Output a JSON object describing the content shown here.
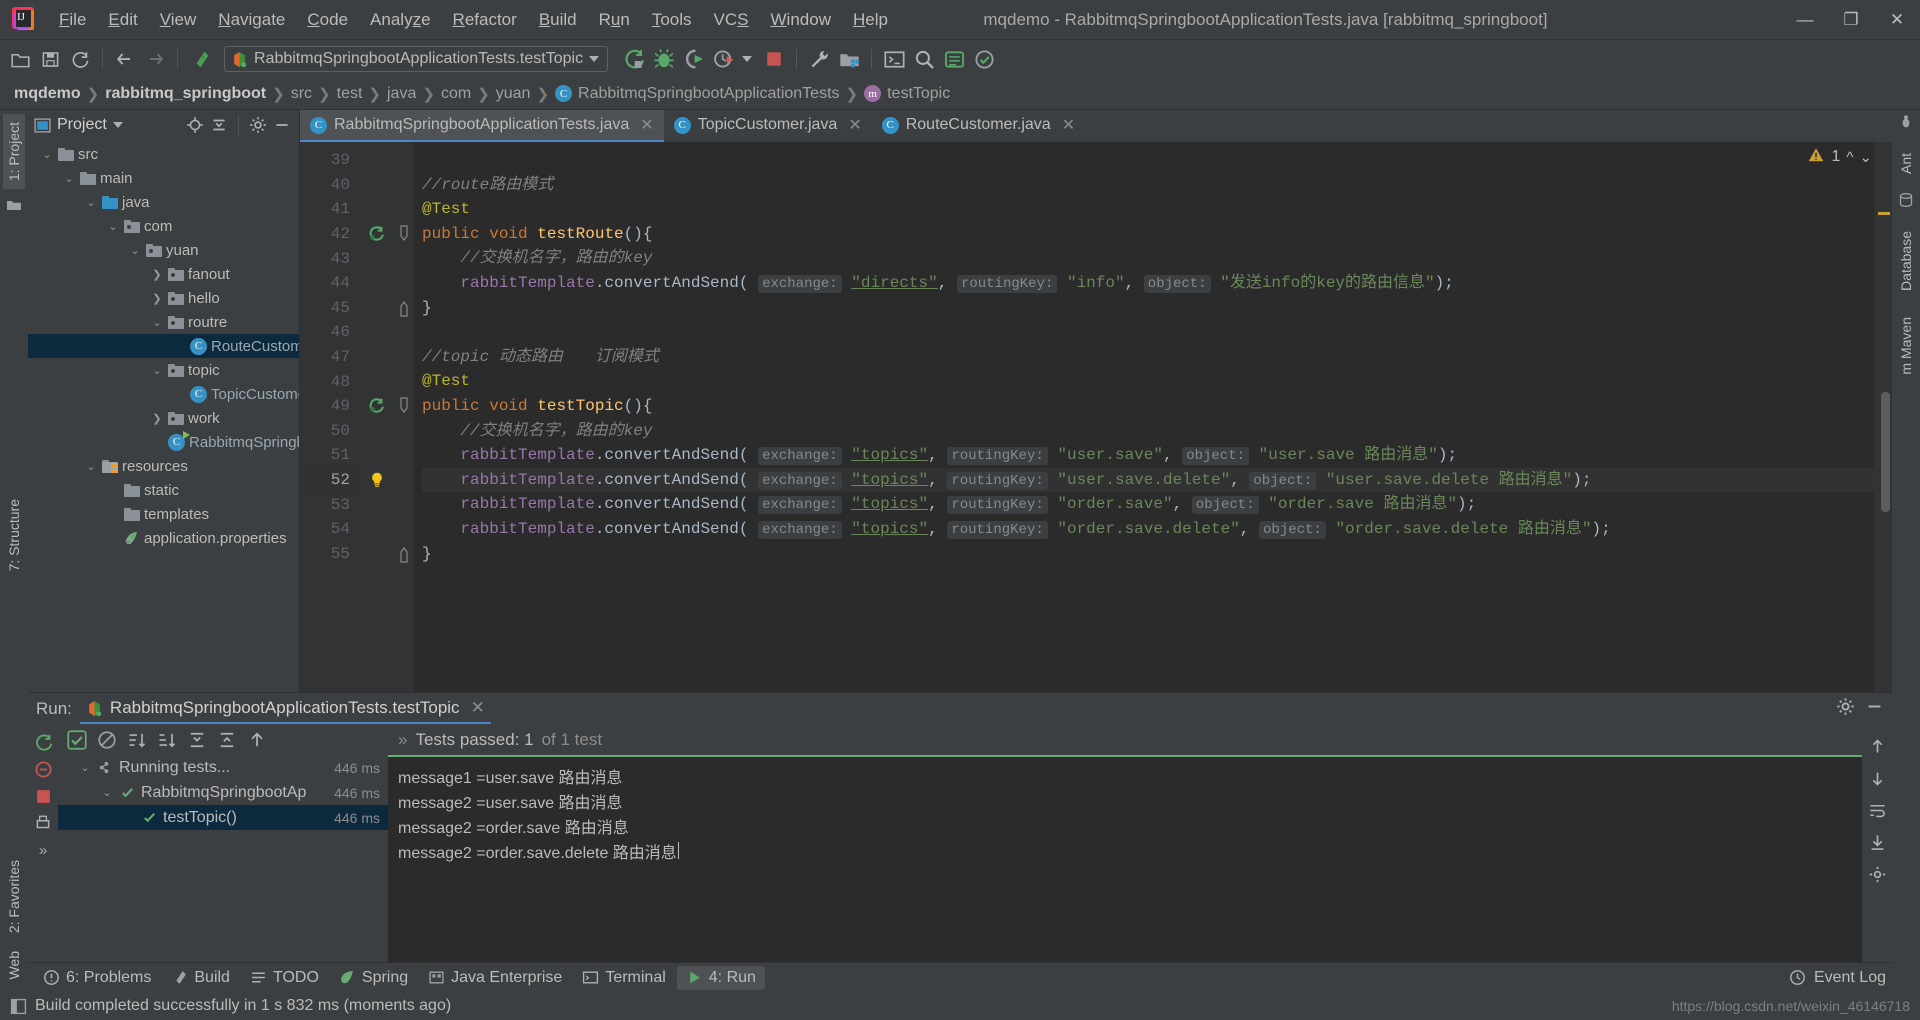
{
  "window": {
    "title": "mqdemo - RabbitmqSpringbootApplicationTests.java [rabbitmq_springboot]",
    "minimize": "—",
    "maximize": "❐",
    "close": "✕"
  },
  "menubar": [
    {
      "label": "File",
      "mnemonic": "F"
    },
    {
      "label": "Edit",
      "mnemonic": "E"
    },
    {
      "label": "View",
      "mnemonic": "V"
    },
    {
      "label": "Navigate",
      "mnemonic": "N"
    },
    {
      "label": "Code",
      "mnemonic": "C"
    },
    {
      "label": "Analyze",
      "mnemonic": "z"
    },
    {
      "label": "Refactor",
      "mnemonic": "R"
    },
    {
      "label": "Build",
      "mnemonic": "B"
    },
    {
      "label": "Run",
      "mnemonic": "u"
    },
    {
      "label": "Tools",
      "mnemonic": "T"
    },
    {
      "label": "VCS",
      "mnemonic": "S"
    },
    {
      "label": "Window",
      "mnemonic": "W"
    },
    {
      "label": "Help",
      "mnemonic": "H"
    }
  ],
  "toolbar": {
    "run_config": "RabbitmqSpringbootApplicationTests.testTopic",
    "icons": [
      "open-folder-icon",
      "save-icon",
      "sync-icon",
      "back-arrow-icon",
      "forward-arrow-icon",
      "build-icon",
      "run-icon",
      "debug-icon",
      "run-coverage-icon",
      "profile-icon",
      "stop-icon",
      "settings-wrench-icon",
      "project-structure-icon",
      "terminal-icon",
      "search-everywhere-icon",
      "database-icon",
      "check-icon"
    ]
  },
  "breadcrumb": [
    {
      "label": "mqdemo",
      "style": "bold"
    },
    {
      "label": "rabbitmq_springboot",
      "style": "bold"
    },
    {
      "label": "src",
      "style": "dim"
    },
    {
      "label": "test",
      "style": "dim"
    },
    {
      "label": "java",
      "style": "dim"
    },
    {
      "label": "com",
      "style": "dim"
    },
    {
      "label": "yuan",
      "style": "dim"
    },
    {
      "label": "RabbitmqSpringbootApplicationTests",
      "style": "class"
    },
    {
      "label": "testTopic",
      "style": "method"
    }
  ],
  "left_tool_tabs": [
    {
      "label": "1: Project",
      "selected": true
    },
    {
      "label": "7: Structure",
      "selected": false
    },
    {
      "label": "2: Favorites",
      "selected": false
    },
    {
      "label": "Web",
      "selected": false
    }
  ],
  "right_tool_tabs": [
    {
      "label": "Ant",
      "selected": false
    },
    {
      "label": "Database",
      "selected": false
    },
    {
      "label": "m Maven",
      "selected": false
    }
  ],
  "project": {
    "title": "Project",
    "tree": [
      {
        "label": "src",
        "depth": 0,
        "arrow": "down",
        "icon": "folder",
        "selected": false
      },
      {
        "label": "main",
        "depth": 1,
        "arrow": "down",
        "icon": "folder",
        "selected": false
      },
      {
        "label": "java",
        "depth": 2,
        "arrow": "down",
        "icon": "folder-source",
        "selected": false
      },
      {
        "label": "com",
        "depth": 3,
        "arrow": "down",
        "icon": "package",
        "selected": false
      },
      {
        "label": "yuan",
        "depth": 4,
        "arrow": "down",
        "icon": "package",
        "selected": false
      },
      {
        "label": "fanout",
        "depth": 5,
        "arrow": "right",
        "icon": "package",
        "selected": false
      },
      {
        "label": "hello",
        "depth": 5,
        "arrow": "right",
        "icon": "package",
        "selected": false
      },
      {
        "label": "routre",
        "depth": 5,
        "arrow": "down",
        "icon": "package",
        "selected": false
      },
      {
        "label": "RouteCustomer",
        "depth": 6,
        "arrow": "none",
        "icon": "class",
        "selected": true
      },
      {
        "label": "topic",
        "depth": 5,
        "arrow": "down",
        "icon": "package",
        "selected": false
      },
      {
        "label": "TopicCustomer",
        "depth": 6,
        "arrow": "none",
        "icon": "class",
        "selected": false
      },
      {
        "label": "work",
        "depth": 5,
        "arrow": "right",
        "icon": "package",
        "selected": false
      },
      {
        "label": "RabbitmqSpringbootApplication",
        "depth": 5,
        "arrow": "none",
        "icon": "class-run",
        "selected": false
      },
      {
        "label": "resources",
        "depth": 2,
        "arrow": "down",
        "icon": "resources",
        "selected": false
      },
      {
        "label": "static",
        "depth": 3,
        "arrow": "none",
        "icon": "folder",
        "selected": false
      },
      {
        "label": "templates",
        "depth": 3,
        "arrow": "none",
        "icon": "folder",
        "selected": false
      },
      {
        "label": "application.properties",
        "depth": 3,
        "arrow": "none",
        "icon": "properties",
        "selected": false
      }
    ]
  },
  "editor_tabs": [
    {
      "label": "RabbitmqSpringbootApplicationTests.java",
      "active": true
    },
    {
      "label": "TopicCustomer.java",
      "active": false
    },
    {
      "label": "RouteCustomer.java",
      "active": false
    }
  ],
  "editor": {
    "warning_count": "1",
    "lines": [
      {
        "n": "39",
        "marker": "",
        "fold": "",
        "current": false
      },
      {
        "n": "40",
        "marker": "",
        "fold": "",
        "current": false
      },
      {
        "n": "41",
        "marker": "",
        "fold": "",
        "current": false
      },
      {
        "n": "42",
        "marker": "run",
        "fold": "fold-start",
        "current": false
      },
      {
        "n": "43",
        "marker": "",
        "fold": "",
        "current": false
      },
      {
        "n": "44",
        "marker": "",
        "fold": "",
        "current": false
      },
      {
        "n": "45",
        "marker": "",
        "fold": "fold-end",
        "current": false
      },
      {
        "n": "46",
        "marker": "",
        "fold": "",
        "current": false
      },
      {
        "n": "47",
        "marker": "",
        "fold": "",
        "current": false
      },
      {
        "n": "48",
        "marker": "",
        "fold": "",
        "current": false
      },
      {
        "n": "49",
        "marker": "run",
        "fold": "fold-start",
        "current": false
      },
      {
        "n": "50",
        "marker": "",
        "fold": "",
        "current": false
      },
      {
        "n": "51",
        "marker": "",
        "fold": "",
        "current": false
      },
      {
        "n": "52",
        "marker": "bulb",
        "fold": "",
        "current": true
      },
      {
        "n": "53",
        "marker": "",
        "fold": "",
        "current": false
      },
      {
        "n": "54",
        "marker": "",
        "fold": "",
        "current": false
      },
      {
        "n": "55",
        "marker": "",
        "fold": "fold-end",
        "current": false
      }
    ],
    "code": {
      "l40_comment": "//route路由模式",
      "l41_annotation": "@Test",
      "l42_kw_public": "public",
      "l42_kw_void": "void",
      "l42_method": "testRoute",
      "l42_tail": "(){",
      "l43_comment": "//交换机名字，路由的key",
      "l44_field": "rabbitTemplate",
      "l44_dot_call": ".convertAndSend(",
      "l44_hint_exchange": "exchange:",
      "l44_exchange": "\"directs\"",
      "l44_hint_routing": "routingKey:",
      "l44_routing": "\"info\"",
      "l44_hint_object": "object:",
      "l44_object": "\"发送info的key的路由信息\"",
      "l44_end": ");",
      "l45_brace": "}",
      "l47_comment": "//topic 动态路由　　订阅模式",
      "l48_annotation": "@Test",
      "l49_method": "testTopic",
      "l50_comment": "//交换机名字，路由的key",
      "l51_exchange": "\"topics\"",
      "l51_routing": "\"user.save\"",
      "l51_object": "\"user.save 路由消息\"",
      "l52_exchange": "\"topics\"",
      "l52_routing": "\"user.save.delete\"",
      "l52_object": "\"user.save.delete 路由消息\"",
      "l53_exchange": "\"topics\"",
      "l53_routing": "\"order.save\"",
      "l53_object": "\"order.save 路由消息\"",
      "l54_exchange": "\"topics\"",
      "l54_routing": "\"order.save.delete\"",
      "l54_object": "\"order.save.delete 路由消息\"",
      "l55_brace": "}"
    }
  },
  "run_panel": {
    "label": "Run:",
    "tab_title": "RabbitmqSpringbootApplicationTests.testTopic",
    "close": "✕",
    "status_text": "Tests passed: 1",
    "status_suffix": "of 1 test",
    "status_prefix_icon": "»",
    "tests": [
      {
        "label": "Running tests...",
        "time": "446 ms",
        "depth": 0,
        "icon": "tests-root",
        "selected": false
      },
      {
        "label": "RabbitmqSpringbootAp",
        "time": "446 ms",
        "depth": 1,
        "icon": "check",
        "selected": false
      },
      {
        "label": "testTopic()",
        "time": "446 ms",
        "depth": 2,
        "icon": "check",
        "selected": true
      }
    ],
    "console_lines": [
      "message1 =user.save 路由消息",
      "message2 =user.save 路由消息",
      "message2 =order.save 路由消息",
      "message2 =order.save.delete 路由消息"
    ]
  },
  "bottom_tabs": [
    {
      "label": "6: Problems",
      "mnemonic": "6",
      "icon": "problems-icon",
      "active": false
    },
    {
      "label": "Build",
      "icon": "build-icon",
      "active": false
    },
    {
      "label": "TODO",
      "icon": "todo-icon",
      "active": false
    },
    {
      "label": "Spring",
      "icon": "spring-leaf-icon",
      "active": false
    },
    {
      "label": "Java Enterprise",
      "icon": "java-enterprise-icon",
      "active": false
    },
    {
      "label": "Terminal",
      "icon": "terminal-icon",
      "active": false
    },
    {
      "label": "4: Run",
      "mnemonic": "4",
      "icon": "run-icon",
      "active": true
    }
  ],
  "event_log": "Event Log",
  "statusbar": {
    "message": "Build completed successfully in 1 s 832 ms (moments ago)",
    "watermark": "https://blog.csdn.net/weixin_46146718"
  },
  "colors": {
    "accent_blue": "#4a88c7",
    "selection": "#0d293e",
    "success_green": "#6aab73",
    "string_green": "#6a8759",
    "keyword_orange": "#cc7832",
    "method_yellow": "#ffc66d",
    "field_purple": "#9876aa",
    "annotation_yellow": "#bbb529",
    "editor_bg": "#2b2b2b",
    "panel_bg": "#3c3f41"
  }
}
